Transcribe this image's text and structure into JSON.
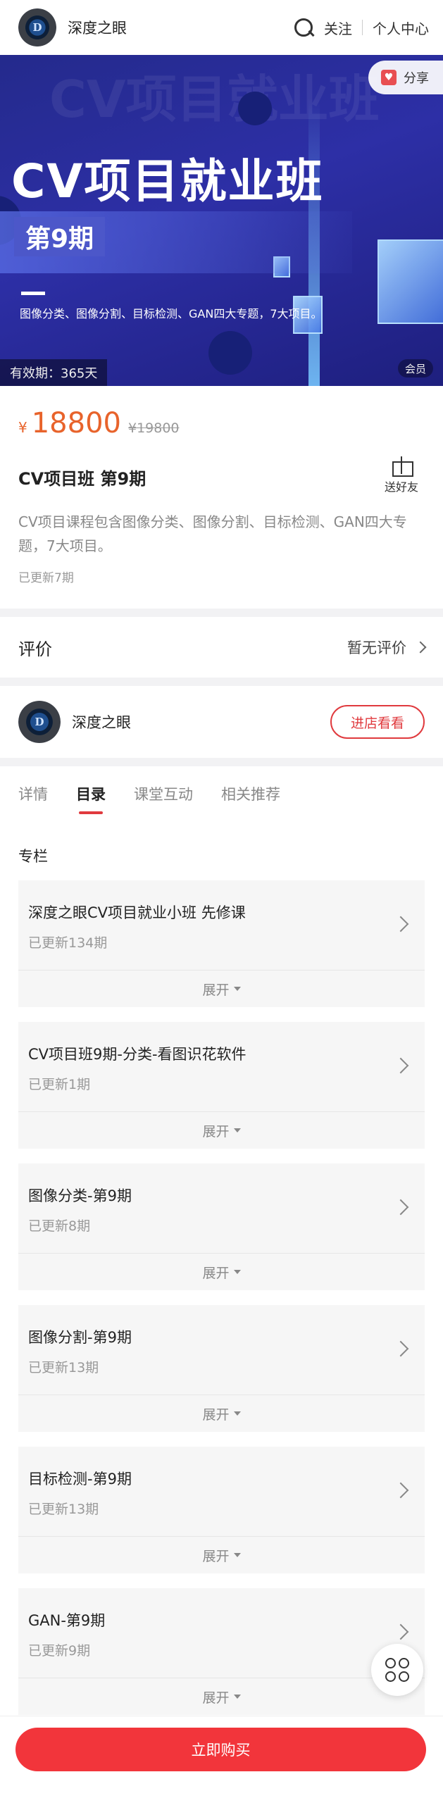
{
  "header": {
    "brand": "深度之眼",
    "follow": "关注",
    "profile": "个人中心"
  },
  "banner": {
    "bg_title": "CV项目就业班",
    "title": "CV项目就业班",
    "subtitle": "第9期",
    "description": "图像分类、图像分割、目标检测、GAN四大专题，7大项目。",
    "share": "分享",
    "validity": "有效期：365天",
    "member_tag": "会员"
  },
  "product": {
    "currency": "¥",
    "price": "18800",
    "original_price": "¥19800",
    "title": "CV项目班 第9期",
    "send_friend": "送好友",
    "description": "CV项目课程包含图像分类、图像分割、目标检测、GAN四大专题，7大项目。",
    "updated": "已更新7期"
  },
  "review": {
    "label": "评价",
    "status": "暂无评价"
  },
  "shop": {
    "name": "深度之眼",
    "visit": "进店看看"
  },
  "tabs": [
    "详情",
    "目录",
    "课堂互动",
    "相关推荐"
  ],
  "section_label": "专栏",
  "columns": [
    {
      "title": "深度之眼CV项目就业小班 先修课",
      "updated": "已更新134期",
      "expand": "展开"
    },
    {
      "title": "CV项目班9期-分类-看图识花软件",
      "updated": "已更新1期",
      "expand": "展开"
    },
    {
      "title": "图像分类-第9期",
      "updated": "已更新8期",
      "expand": "展开"
    },
    {
      "title": "图像分割-第9期",
      "updated": "已更新13期",
      "expand": "展开"
    },
    {
      "title": "目标检测-第9期",
      "updated": "已更新13期",
      "expand": "展开"
    },
    {
      "title": "GAN-第9期",
      "updated": "已更新9期",
      "expand": "展开"
    }
  ],
  "bottom": {
    "buy": "立即购买"
  },
  "colors": {
    "accent": "#e03a3e",
    "price": "#e8632b",
    "banner": "#2d2fa6"
  }
}
